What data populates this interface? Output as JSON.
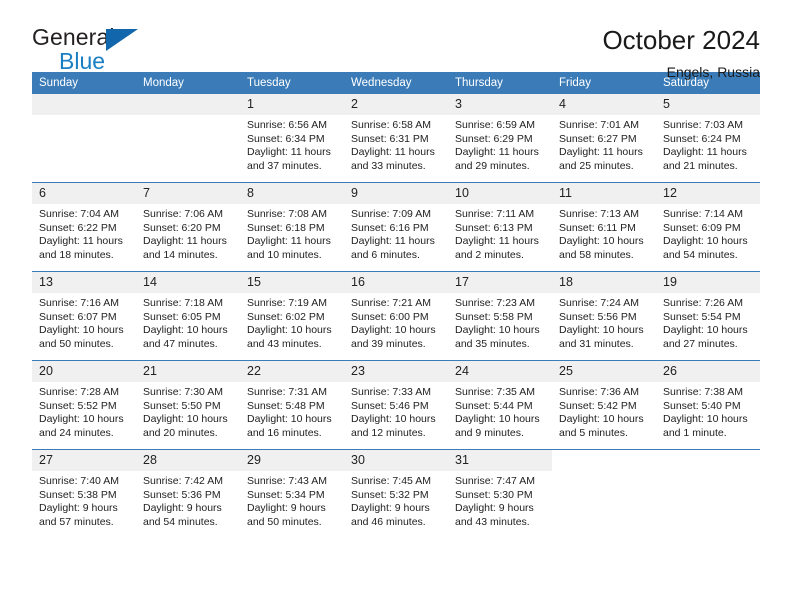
{
  "brand": {
    "name_top": "General",
    "name_bottom": "Blue",
    "triangle_color": "#1266ab",
    "blue_text_color": "#1b7fc4"
  },
  "header": {
    "title": "October 2024",
    "location": "Engels, Russia"
  },
  "theme": {
    "header_bg": "#3b7cb8",
    "daynum_bg": "#f0f0f0",
    "cell_bg": "#ffffff",
    "row_divider": "#3b7cb8"
  },
  "weekdays": [
    "Sunday",
    "Monday",
    "Tuesday",
    "Wednesday",
    "Thursday",
    "Friday",
    "Saturday"
  ],
  "weeks": [
    [
      {
        "day": "",
        "sunrise": "",
        "sunset": "",
        "daylight1": "",
        "daylight2": "",
        "empty": true
      },
      {
        "day": "",
        "sunrise": "",
        "sunset": "",
        "daylight1": "",
        "daylight2": "",
        "empty": true
      },
      {
        "day": "1",
        "sunrise": "Sunrise: 6:56 AM",
        "sunset": "Sunset: 6:34 PM",
        "daylight1": "Daylight: 11 hours",
        "daylight2": "and 37 minutes."
      },
      {
        "day": "2",
        "sunrise": "Sunrise: 6:58 AM",
        "sunset": "Sunset: 6:31 PM",
        "daylight1": "Daylight: 11 hours",
        "daylight2": "and 33 minutes."
      },
      {
        "day": "3",
        "sunrise": "Sunrise: 6:59 AM",
        "sunset": "Sunset: 6:29 PM",
        "daylight1": "Daylight: 11 hours",
        "daylight2": "and 29 minutes."
      },
      {
        "day": "4",
        "sunrise": "Sunrise: 7:01 AM",
        "sunset": "Sunset: 6:27 PM",
        "daylight1": "Daylight: 11 hours",
        "daylight2": "and 25 minutes."
      },
      {
        "day": "5",
        "sunrise": "Sunrise: 7:03 AM",
        "sunset": "Sunset: 6:24 PM",
        "daylight1": "Daylight: 11 hours",
        "daylight2": "and 21 minutes."
      }
    ],
    [
      {
        "day": "6",
        "sunrise": "Sunrise: 7:04 AM",
        "sunset": "Sunset: 6:22 PM",
        "daylight1": "Daylight: 11 hours",
        "daylight2": "and 18 minutes."
      },
      {
        "day": "7",
        "sunrise": "Sunrise: 7:06 AM",
        "sunset": "Sunset: 6:20 PM",
        "daylight1": "Daylight: 11 hours",
        "daylight2": "and 14 minutes."
      },
      {
        "day": "8",
        "sunrise": "Sunrise: 7:08 AM",
        "sunset": "Sunset: 6:18 PM",
        "daylight1": "Daylight: 11 hours",
        "daylight2": "and 10 minutes."
      },
      {
        "day": "9",
        "sunrise": "Sunrise: 7:09 AM",
        "sunset": "Sunset: 6:16 PM",
        "daylight1": "Daylight: 11 hours",
        "daylight2": "and 6 minutes."
      },
      {
        "day": "10",
        "sunrise": "Sunrise: 7:11 AM",
        "sunset": "Sunset: 6:13 PM",
        "daylight1": "Daylight: 11 hours",
        "daylight2": "and 2 minutes."
      },
      {
        "day": "11",
        "sunrise": "Sunrise: 7:13 AM",
        "sunset": "Sunset: 6:11 PM",
        "daylight1": "Daylight: 10 hours",
        "daylight2": "and 58 minutes."
      },
      {
        "day": "12",
        "sunrise": "Sunrise: 7:14 AM",
        "sunset": "Sunset: 6:09 PM",
        "daylight1": "Daylight: 10 hours",
        "daylight2": "and 54 minutes."
      }
    ],
    [
      {
        "day": "13",
        "sunrise": "Sunrise: 7:16 AM",
        "sunset": "Sunset: 6:07 PM",
        "daylight1": "Daylight: 10 hours",
        "daylight2": "and 50 minutes."
      },
      {
        "day": "14",
        "sunrise": "Sunrise: 7:18 AM",
        "sunset": "Sunset: 6:05 PM",
        "daylight1": "Daylight: 10 hours",
        "daylight2": "and 47 minutes."
      },
      {
        "day": "15",
        "sunrise": "Sunrise: 7:19 AM",
        "sunset": "Sunset: 6:02 PM",
        "daylight1": "Daylight: 10 hours",
        "daylight2": "and 43 minutes."
      },
      {
        "day": "16",
        "sunrise": "Sunrise: 7:21 AM",
        "sunset": "Sunset: 6:00 PM",
        "daylight1": "Daylight: 10 hours",
        "daylight2": "and 39 minutes."
      },
      {
        "day": "17",
        "sunrise": "Sunrise: 7:23 AM",
        "sunset": "Sunset: 5:58 PM",
        "daylight1": "Daylight: 10 hours",
        "daylight2": "and 35 minutes."
      },
      {
        "day": "18",
        "sunrise": "Sunrise: 7:24 AM",
        "sunset": "Sunset: 5:56 PM",
        "daylight1": "Daylight: 10 hours",
        "daylight2": "and 31 minutes."
      },
      {
        "day": "19",
        "sunrise": "Sunrise: 7:26 AM",
        "sunset": "Sunset: 5:54 PM",
        "daylight1": "Daylight: 10 hours",
        "daylight2": "and 27 minutes."
      }
    ],
    [
      {
        "day": "20",
        "sunrise": "Sunrise: 7:28 AM",
        "sunset": "Sunset: 5:52 PM",
        "daylight1": "Daylight: 10 hours",
        "daylight2": "and 24 minutes."
      },
      {
        "day": "21",
        "sunrise": "Sunrise: 7:30 AM",
        "sunset": "Sunset: 5:50 PM",
        "daylight1": "Daylight: 10 hours",
        "daylight2": "and 20 minutes."
      },
      {
        "day": "22",
        "sunrise": "Sunrise: 7:31 AM",
        "sunset": "Sunset: 5:48 PM",
        "daylight1": "Daylight: 10 hours",
        "daylight2": "and 16 minutes."
      },
      {
        "day": "23",
        "sunrise": "Sunrise: 7:33 AM",
        "sunset": "Sunset: 5:46 PM",
        "daylight1": "Daylight: 10 hours",
        "daylight2": "and 12 minutes."
      },
      {
        "day": "24",
        "sunrise": "Sunrise: 7:35 AM",
        "sunset": "Sunset: 5:44 PM",
        "daylight1": "Daylight: 10 hours",
        "daylight2": "and 9 minutes."
      },
      {
        "day": "25",
        "sunrise": "Sunrise: 7:36 AM",
        "sunset": "Sunset: 5:42 PM",
        "daylight1": "Daylight: 10 hours",
        "daylight2": "and 5 minutes."
      },
      {
        "day": "26",
        "sunrise": "Sunrise: 7:38 AM",
        "sunset": "Sunset: 5:40 PM",
        "daylight1": "Daylight: 10 hours",
        "daylight2": "and 1 minute."
      }
    ],
    [
      {
        "day": "27",
        "sunrise": "Sunrise: 7:40 AM",
        "sunset": "Sunset: 5:38 PM",
        "daylight1": "Daylight: 9 hours",
        "daylight2": "and 57 minutes."
      },
      {
        "day": "28",
        "sunrise": "Sunrise: 7:42 AM",
        "sunset": "Sunset: 5:36 PM",
        "daylight1": "Daylight: 9 hours",
        "daylight2": "and 54 minutes."
      },
      {
        "day": "29",
        "sunrise": "Sunrise: 7:43 AM",
        "sunset": "Sunset: 5:34 PM",
        "daylight1": "Daylight: 9 hours",
        "daylight2": "and 50 minutes."
      },
      {
        "day": "30",
        "sunrise": "Sunrise: 7:45 AM",
        "sunset": "Sunset: 5:32 PM",
        "daylight1": "Daylight: 9 hours",
        "daylight2": "and 46 minutes."
      },
      {
        "day": "31",
        "sunrise": "Sunrise: 7:47 AM",
        "sunset": "Sunset: 5:30 PM",
        "daylight1": "Daylight: 9 hours",
        "daylight2": "and 43 minutes."
      },
      {
        "day": "",
        "sunrise": "",
        "sunset": "",
        "daylight1": "",
        "daylight2": "",
        "blank": true
      },
      {
        "day": "",
        "sunrise": "",
        "sunset": "",
        "daylight1": "",
        "daylight2": "",
        "blank": true
      }
    ]
  ]
}
